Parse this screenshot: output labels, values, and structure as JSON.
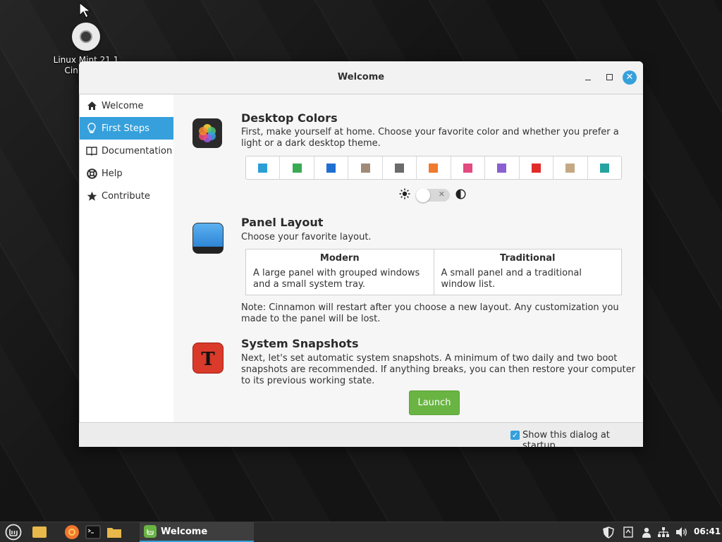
{
  "desktop": {
    "icon_label_line1": "Linux Mint 21.1",
    "icon_label_line2": "Cinnamon"
  },
  "window": {
    "title": "Welcome",
    "close_glyph": "✕"
  },
  "sidebar": {
    "items": [
      {
        "label": "Welcome",
        "icon": "home-icon",
        "active": false
      },
      {
        "label": "First Steps",
        "icon": "lightbulb-icon",
        "active": true
      },
      {
        "label": "Documentation",
        "icon": "book-icon",
        "active": false
      },
      {
        "label": "Help",
        "icon": "lifebuoy-icon",
        "active": false
      },
      {
        "label": "Contribute",
        "icon": "star-icon",
        "active": false
      }
    ]
  },
  "sections": {
    "colors": {
      "title": "Desktop Colors",
      "text": "First, make yourself at home. Choose your favorite color and whether you prefer a light or a dark desktop theme.",
      "swatches": [
        "#2a9fd6",
        "#3aaa55",
        "#1f6fd1",
        "#a08a78",
        "#6b6b6b",
        "#f07a2e",
        "#e24a80",
        "#8a5fd1",
        "#e02b2b",
        "#c4a984",
        "#26a3a0"
      ]
    },
    "layout": {
      "title": "Panel Layout",
      "text": "Choose your favorite layout.",
      "options": [
        {
          "title": "Modern",
          "desc": "A large panel with grouped windows and a small system tray."
        },
        {
          "title": "Traditional",
          "desc": "A small panel and a traditional window list."
        }
      ],
      "note": "Note: Cinnamon will restart after you choose a new layout. Any customization you made to the panel will be lost."
    },
    "snapshots": {
      "title": "System Snapshots",
      "text": "Next, let's set automatic system snapshots. A minimum of two daily and two boot snapshots are recommended. If anything breaks, you can then restore your computer to its previous working state.",
      "button": "Launch"
    }
  },
  "footer": {
    "checkbox_label": "Show this dialog at startup",
    "checked": true
  },
  "taskbar": {
    "window_label": "Welcome",
    "clock": "06:41"
  },
  "colors": {
    "accent": "#35a0dc",
    "launch": "#6ab443"
  }
}
